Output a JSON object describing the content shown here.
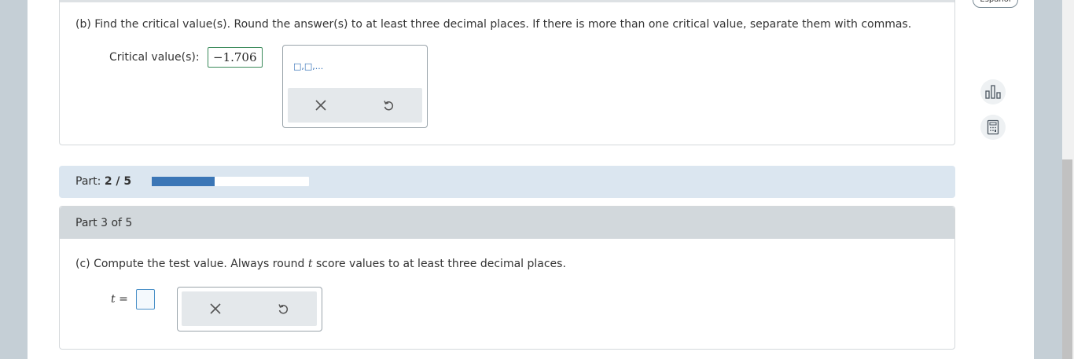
{
  "header": {
    "language_button": "Español"
  },
  "part_b": {
    "question": "(b) Find the critical value(s). Round the answer(s) to at least three decimal places. If there is more than one critical value, separate them with commas.",
    "answer_label": "Critical value(s):",
    "answer_value": "−1.706",
    "template_symbol": "□,□,..."
  },
  "progress": {
    "label": "Part:",
    "current": "2 / 5",
    "fraction": 0.4
  },
  "part_c": {
    "header": "Part 3 of 5",
    "question_prefix": "(c) Compute the test value. Always round ",
    "question_var": "t",
    "question_suffix": " score values to at least three decimal places.",
    "answer_var": "t",
    "answer_eq": "=",
    "answer_value": ""
  },
  "icons": {
    "clear": "close-icon",
    "undo": "undo-icon",
    "stats": "bar-chart-icon",
    "calculator": "calculator-icon"
  },
  "colors": {
    "progress_fill": "#3b76b6",
    "accent_box": "#4a90c8",
    "answer_border": "#3a8a5a"
  }
}
